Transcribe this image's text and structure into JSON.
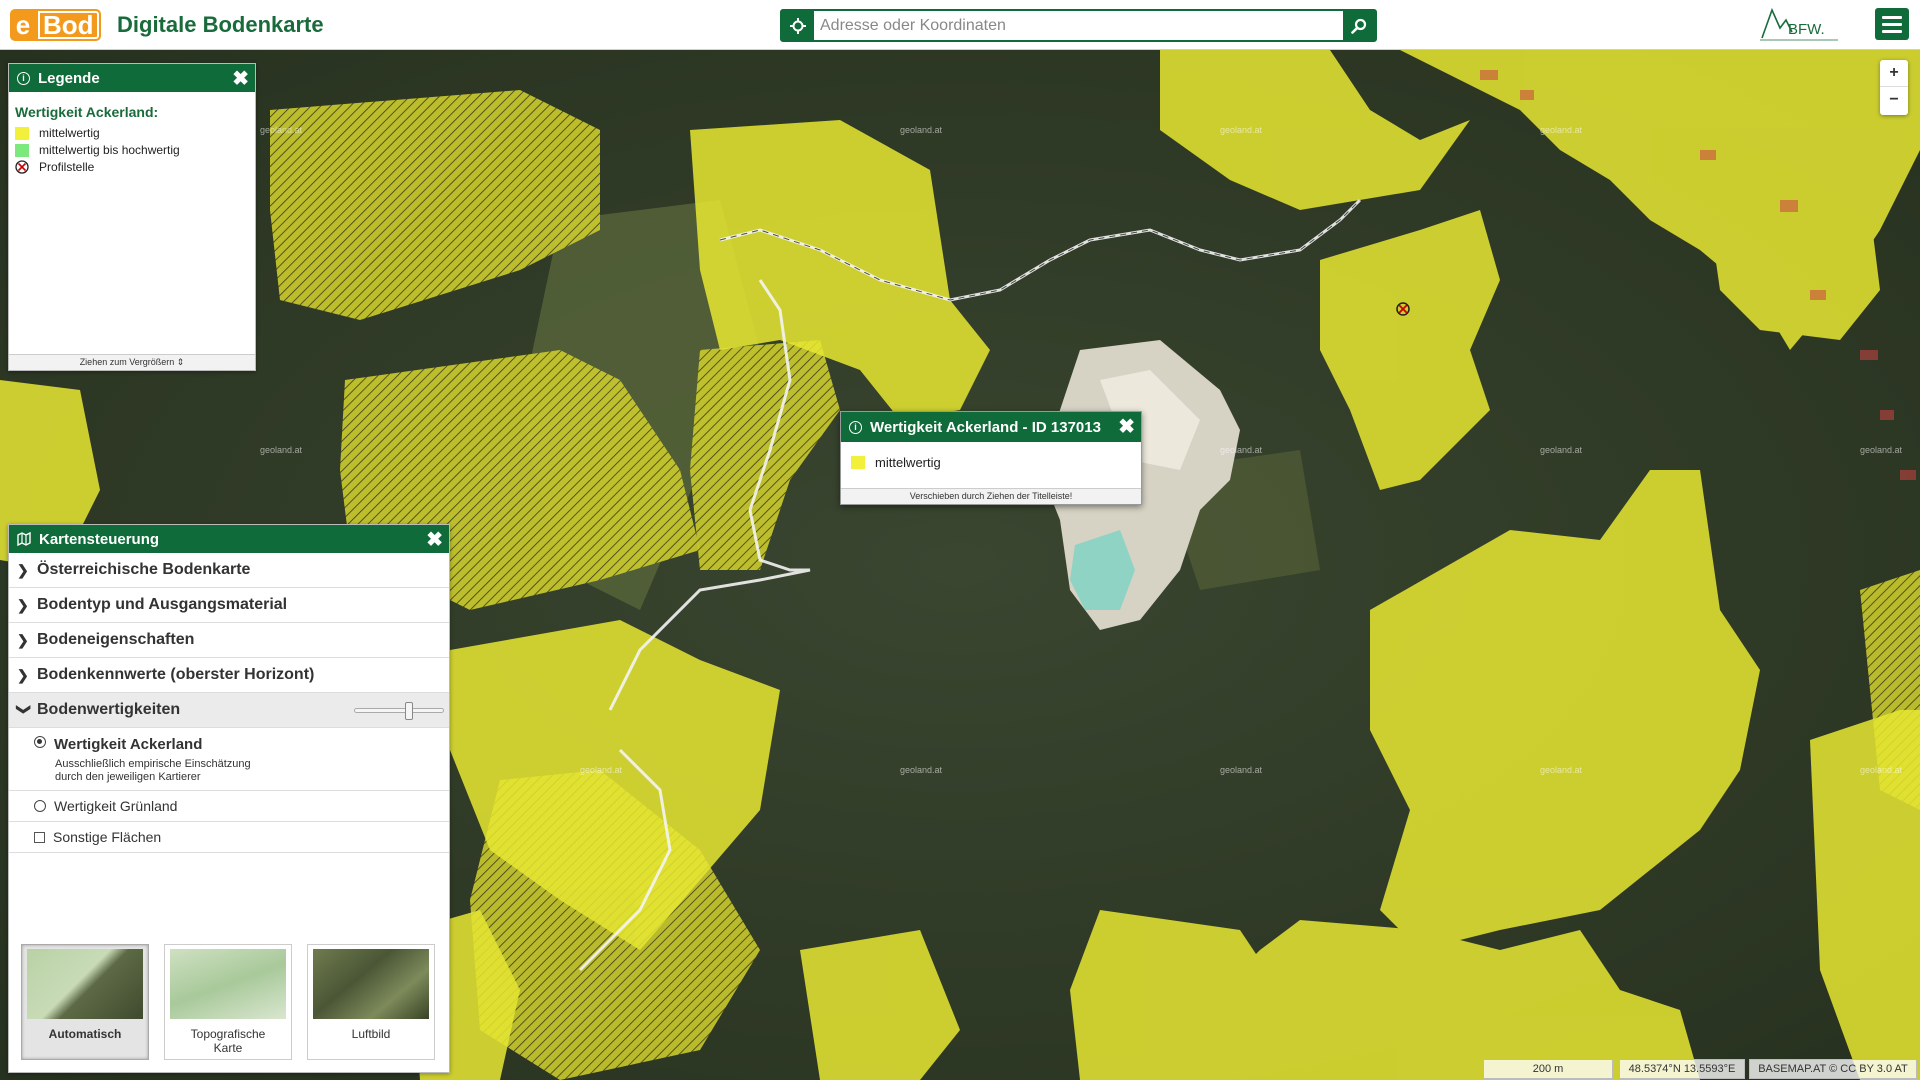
{
  "header": {
    "logo_e": "e",
    "logo_bod": "Bod",
    "title": "Digitale Bodenkarte",
    "search_placeholder": "Adresse oder Koordinaten",
    "brand_logo_text": "BFW."
  },
  "map": {
    "watermark": "geoland.at",
    "zoom_in": "+",
    "zoom_out": "−"
  },
  "legend": {
    "title": "Legende",
    "heading": "Wertigkeit Ackerland:",
    "items": [
      {
        "label": "mittelwertig",
        "color": "#f2f03a"
      },
      {
        "label": "mittelwertig bis hochwertig",
        "color": "#7de87d"
      },
      {
        "label": "Profilstelle",
        "icon": "profile-point-icon"
      }
    ],
    "drag_hint": "Ziehen zum Vergrößern"
  },
  "popup": {
    "title": "Wertigkeit Ackerland - ID 137013",
    "value": "mittelwertig",
    "value_color": "#f2f03a",
    "footer": "Verschieben durch Ziehen der Titelleiste!"
  },
  "controls": {
    "title": "Kartensteuerung",
    "sections": [
      "Österreichische Bodenkarte",
      "Bodentyp und Ausgangsmaterial",
      "Bodeneigenschaften",
      "Bodenkennwerte (oberster Horizont)",
      "Bodenwertigkeiten"
    ],
    "options": {
      "ackerland": "Wertigkeit Ackerland",
      "ackerland_desc_1": "Ausschließlich empirische Einschätzung",
      "ackerland_desc_2": "durch den jeweiligen Kartierer",
      "gruenland": "Wertigkeit Grünland",
      "sonstige": "Sonstige Flächen"
    },
    "basemaps": [
      {
        "line1": "Automatisch",
        "line2": ""
      },
      {
        "line1": "Topografische",
        "line2": "Karte"
      },
      {
        "line1": "Luftbild",
        "line2": ""
      }
    ]
  },
  "status": {
    "scale": "200 m",
    "coords": "48.5374°N 13.5593°E",
    "attribution": "BASEMAP.AT © CC BY 3.0 AT"
  },
  "colors": {
    "brand_green": "#0f6b3a",
    "brand_orange": "#f39a1d",
    "map_yellow": "#e6e632",
    "forest": "#2f3a25"
  }
}
